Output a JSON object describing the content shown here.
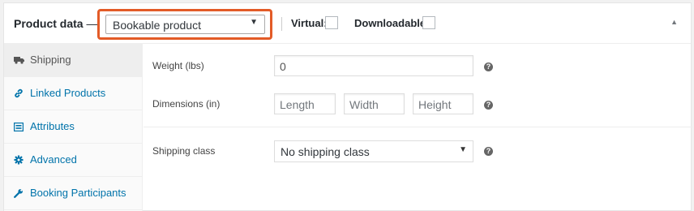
{
  "header": {
    "title": "Product data",
    "dash": "—",
    "product_type": "Bookable product",
    "virtual_label": "Virtual:",
    "downloadable_label": "Downloadable:",
    "collapse_glyph": "▲"
  },
  "tabs": [
    {
      "label": "Shipping",
      "icon": "truck-icon",
      "active": true
    },
    {
      "label": "Linked Products",
      "icon": "link-icon",
      "active": false
    },
    {
      "label": "Attributes",
      "icon": "list-icon",
      "active": false
    },
    {
      "label": "Advanced",
      "icon": "gear-icon",
      "active": false
    },
    {
      "label": "Booking Participants",
      "icon": "wrench-icon",
      "active": false
    }
  ],
  "shipping": {
    "weight_label": "Weight (lbs)",
    "weight_value": "0",
    "dimensions_label": "Dimensions (in)",
    "length_placeholder": "Length",
    "width_placeholder": "Width",
    "height_placeholder": "Height",
    "shipping_class_label": "Shipping class",
    "shipping_class_value": "No shipping class",
    "help_glyph": "?"
  },
  "colors": {
    "highlight": "#e35b27",
    "link": "#0073aa"
  }
}
